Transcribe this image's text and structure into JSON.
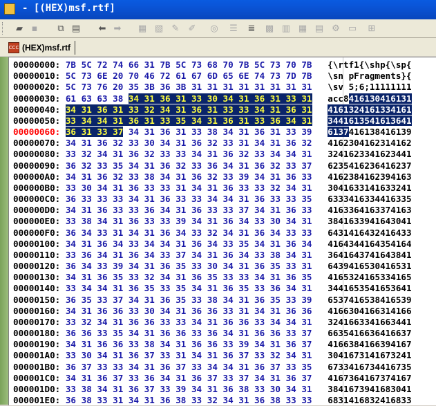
{
  "window": {
    "title": "- [(HEX)msf.rtf]"
  },
  "toolbar": {
    "buttons": [
      {
        "name": "open-folder-icon",
        "glyph": "▰",
        "disabled": false
      },
      {
        "name": "save-icon",
        "glyph": "▪",
        "disabled": true
      },
      {
        "name": "copy-icon",
        "glyph": "⧉",
        "disabled": false
      },
      {
        "name": "paste-icon",
        "glyph": "▤",
        "disabled": false
      },
      {
        "name": "back-arrow-icon",
        "glyph": "⬅",
        "disabled": false
      },
      {
        "name": "forward-arrow-icon",
        "glyph": "➡",
        "disabled": true
      },
      {
        "name": "tool-1-icon",
        "glyph": "▦",
        "disabled": true
      },
      {
        "name": "tool-2-icon",
        "glyph": "▧",
        "disabled": true
      },
      {
        "name": "tool-3-icon",
        "glyph": "✎",
        "disabled": true
      },
      {
        "name": "tool-4-icon",
        "glyph": "✐",
        "disabled": true
      },
      {
        "name": "tool-5-icon",
        "glyph": "◎",
        "disabled": true
      },
      {
        "name": "tool-6-icon",
        "glyph": "☰",
        "disabled": true
      },
      {
        "name": "align-icon",
        "glyph": "≣",
        "disabled": false
      },
      {
        "name": "tool-7-icon",
        "glyph": "▩",
        "disabled": true
      },
      {
        "name": "tool-8-icon",
        "glyph": "▥",
        "disabled": true
      },
      {
        "name": "tool-9-icon",
        "glyph": "▦",
        "disabled": true
      },
      {
        "name": "tool-10-icon",
        "glyph": "▤",
        "disabled": true
      },
      {
        "name": "tool-11-icon",
        "glyph": "⚙",
        "disabled": true
      },
      {
        "name": "tool-12-icon",
        "glyph": "▭",
        "disabled": true
      },
      {
        "name": "grid-icon",
        "glyph": "⊞",
        "disabled": true
      }
    ]
  },
  "tab": {
    "label": "(HEX)msf.rtf",
    "icon_text": "CCC"
  },
  "hex": {
    "rows": [
      {
        "offset": "00000000:",
        "bytes": [
          "7B",
          "5C",
          "72",
          "74",
          "66",
          "31",
          "7B",
          "5C",
          "73",
          "68",
          "70",
          "7B",
          "5C",
          "73",
          "70",
          "7B"
        ],
        "ascii": "{\\rtf1{\\shp{\\sp{"
      },
      {
        "offset": "00000010:",
        "bytes": [
          "5C",
          "73",
          "6E",
          "20",
          "70",
          "46",
          "72",
          "61",
          "67",
          "6D",
          "65",
          "6E",
          "74",
          "73",
          "7D",
          "7B"
        ],
        "ascii": "\\sn pFragments}{"
      },
      {
        "offset": "00000020:",
        "bytes": [
          "5C",
          "73",
          "76",
          "20",
          "35",
          "3B",
          "36",
          "3B",
          "31",
          "31",
          "31",
          "31",
          "31",
          "31",
          "31",
          "31"
        ],
        "ascii": "\\sv 5;6;11111111"
      },
      {
        "offset": "00000030:",
        "bytes": [
          "61",
          "63",
          "63",
          "38",
          "34",
          "31",
          "36",
          "31",
          "33",
          "30",
          "34",
          "31",
          "36",
          "31",
          "33",
          "31"
        ],
        "ascii": "acc8416130416131",
        "sel_from": 4
      },
      {
        "offset": "00000040:",
        "bytes": [
          "34",
          "31",
          "36",
          "31",
          "33",
          "32",
          "34",
          "31",
          "36",
          "31",
          "33",
          "33",
          "34",
          "31",
          "36",
          "31"
        ],
        "ascii": "4161324161334161",
        "sel_from": 0
      },
      {
        "offset": "00000050:",
        "bytes": [
          "33",
          "34",
          "34",
          "31",
          "36",
          "31",
          "33",
          "35",
          "34",
          "31",
          "36",
          "31",
          "33",
          "36",
          "34",
          "31"
        ],
        "ascii": "3441613541613641",
        "sel_from": 0
      },
      {
        "offset": "00000060:",
        "bytes": [
          "36",
          "31",
          "33",
          "37",
          "34",
          "31",
          "36",
          "31",
          "33",
          "38",
          "34",
          "31",
          "36",
          "31",
          "33",
          "39"
        ],
        "ascii": "6137416138416139",
        "sel_from": 0,
        "sel_to": 4,
        "current": true
      },
      {
        "offset": "00000070:",
        "bytes": [
          "34",
          "31",
          "36",
          "32",
          "33",
          "30",
          "34",
          "31",
          "36",
          "32",
          "33",
          "31",
          "34",
          "31",
          "36",
          "32"
        ],
        "ascii": "4162304162314162"
      },
      {
        "offset": "00000080:",
        "bytes": [
          "33",
          "32",
          "34",
          "31",
          "36",
          "32",
          "33",
          "33",
          "34",
          "31",
          "36",
          "32",
          "33",
          "34",
          "34",
          "31"
        ],
        "ascii": "3241623341623441"
      },
      {
        "offset": "00000090:",
        "bytes": [
          "36",
          "32",
          "33",
          "35",
          "34",
          "31",
          "36",
          "32",
          "33",
          "36",
          "34",
          "31",
          "36",
          "32",
          "33",
          "37"
        ],
        "ascii": "6235416236416237"
      },
      {
        "offset": "000000A0:",
        "bytes": [
          "34",
          "31",
          "36",
          "32",
          "33",
          "38",
          "34",
          "31",
          "36",
          "32",
          "33",
          "39",
          "34",
          "31",
          "36",
          "33"
        ],
        "ascii": "4162384162394163"
      },
      {
        "offset": "000000B0:",
        "bytes": [
          "33",
          "30",
          "34",
          "31",
          "36",
          "33",
          "33",
          "31",
          "34",
          "31",
          "36",
          "33",
          "33",
          "32",
          "34",
          "31"
        ],
        "ascii": "3041633141633241"
      },
      {
        "offset": "000000C0:",
        "bytes": [
          "36",
          "33",
          "33",
          "33",
          "34",
          "31",
          "36",
          "33",
          "33",
          "34",
          "34",
          "31",
          "36",
          "33",
          "33",
          "35"
        ],
        "ascii": "6333416334416335"
      },
      {
        "offset": "000000D0:",
        "bytes": [
          "34",
          "31",
          "36",
          "33",
          "33",
          "36",
          "34",
          "31",
          "36",
          "33",
          "33",
          "37",
          "34",
          "31",
          "36",
          "33"
        ],
        "ascii": "4163364163374163"
      },
      {
        "offset": "000000E0:",
        "bytes": [
          "33",
          "38",
          "34",
          "31",
          "36",
          "33",
          "33",
          "39",
          "34",
          "31",
          "36",
          "34",
          "33",
          "30",
          "34",
          "31"
        ],
        "ascii": "3841633941643041"
      },
      {
        "offset": "000000F0:",
        "bytes": [
          "36",
          "34",
          "33",
          "31",
          "34",
          "31",
          "36",
          "34",
          "33",
          "32",
          "34",
          "31",
          "36",
          "34",
          "33",
          "33"
        ],
        "ascii": "6431416432416433"
      },
      {
        "offset": "00000100:",
        "bytes": [
          "34",
          "31",
          "36",
          "34",
          "33",
          "34",
          "34",
          "31",
          "36",
          "34",
          "33",
          "35",
          "34",
          "31",
          "36",
          "34"
        ],
        "ascii": "4164344164354164"
      },
      {
        "offset": "00000110:",
        "bytes": [
          "33",
          "36",
          "34",
          "31",
          "36",
          "34",
          "33",
          "37",
          "34",
          "31",
          "36",
          "34",
          "33",
          "38",
          "34",
          "31"
        ],
        "ascii": "3641643741643841"
      },
      {
        "offset": "00000120:",
        "bytes": [
          "36",
          "34",
          "33",
          "39",
          "34",
          "31",
          "36",
          "35",
          "33",
          "30",
          "34",
          "31",
          "36",
          "35",
          "33",
          "31"
        ],
        "ascii": "6439416530416531"
      },
      {
        "offset": "00000130:",
        "bytes": [
          "34",
          "31",
          "36",
          "35",
          "33",
          "32",
          "34",
          "31",
          "36",
          "35",
          "33",
          "33",
          "34",
          "31",
          "36",
          "35"
        ],
        "ascii": "4165324165334165"
      },
      {
        "offset": "00000140:",
        "bytes": [
          "33",
          "34",
          "34",
          "31",
          "36",
          "35",
          "33",
          "35",
          "34",
          "31",
          "36",
          "35",
          "33",
          "36",
          "34",
          "31"
        ],
        "ascii": "3441653541653641"
      },
      {
        "offset": "00000150:",
        "bytes": [
          "36",
          "35",
          "33",
          "37",
          "34",
          "31",
          "36",
          "35",
          "33",
          "38",
          "34",
          "31",
          "36",
          "35",
          "33",
          "39"
        ],
        "ascii": "6537416538416539"
      },
      {
        "offset": "00000160:",
        "bytes": [
          "34",
          "31",
          "36",
          "36",
          "33",
          "30",
          "34",
          "31",
          "36",
          "36",
          "33",
          "31",
          "34",
          "31",
          "36",
          "36"
        ],
        "ascii": "4166304166314166"
      },
      {
        "offset": "00000170:",
        "bytes": [
          "33",
          "32",
          "34",
          "31",
          "36",
          "36",
          "33",
          "33",
          "34",
          "31",
          "36",
          "36",
          "33",
          "34",
          "34",
          "31"
        ],
        "ascii": "3241663341663441"
      },
      {
        "offset": "00000180:",
        "bytes": [
          "36",
          "36",
          "33",
          "35",
          "34",
          "31",
          "36",
          "36",
          "33",
          "36",
          "34",
          "31",
          "36",
          "36",
          "33",
          "37"
        ],
        "ascii": "6635416636416637"
      },
      {
        "offset": "00000190:",
        "bytes": [
          "34",
          "31",
          "36",
          "36",
          "33",
          "38",
          "34",
          "31",
          "36",
          "36",
          "33",
          "39",
          "34",
          "31",
          "36",
          "37"
        ],
        "ascii": "4166384166394167"
      },
      {
        "offset": "000001A0:",
        "bytes": [
          "33",
          "30",
          "34",
          "31",
          "36",
          "37",
          "33",
          "31",
          "34",
          "31",
          "36",
          "37",
          "33",
          "32",
          "34",
          "31"
        ],
        "ascii": "3041673141673241"
      },
      {
        "offset": "000001B0:",
        "bytes": [
          "36",
          "37",
          "33",
          "33",
          "34",
          "31",
          "36",
          "37",
          "33",
          "34",
          "34",
          "31",
          "36",
          "37",
          "33",
          "35"
        ],
        "ascii": "6733416734416735"
      },
      {
        "offset": "000001C0:",
        "bytes": [
          "34",
          "31",
          "36",
          "37",
          "33",
          "36",
          "34",
          "31",
          "36",
          "37",
          "33",
          "37",
          "34",
          "31",
          "36",
          "37"
        ],
        "ascii": "4167364167374167"
      },
      {
        "offset": "000001D0:",
        "bytes": [
          "33",
          "38",
          "34",
          "31",
          "36",
          "37",
          "33",
          "39",
          "34",
          "31",
          "36",
          "38",
          "33",
          "30",
          "34",
          "31"
        ],
        "ascii": "3841673941683041"
      },
      {
        "offset": "000001E0:",
        "bytes": [
          "36",
          "38",
          "33",
          "31",
          "34",
          "31",
          "36",
          "38",
          "33",
          "32",
          "34",
          "31",
          "36",
          "38",
          "33",
          "33"
        ],
        "ascii": "6831416832416833"
      }
    ]
  }
}
